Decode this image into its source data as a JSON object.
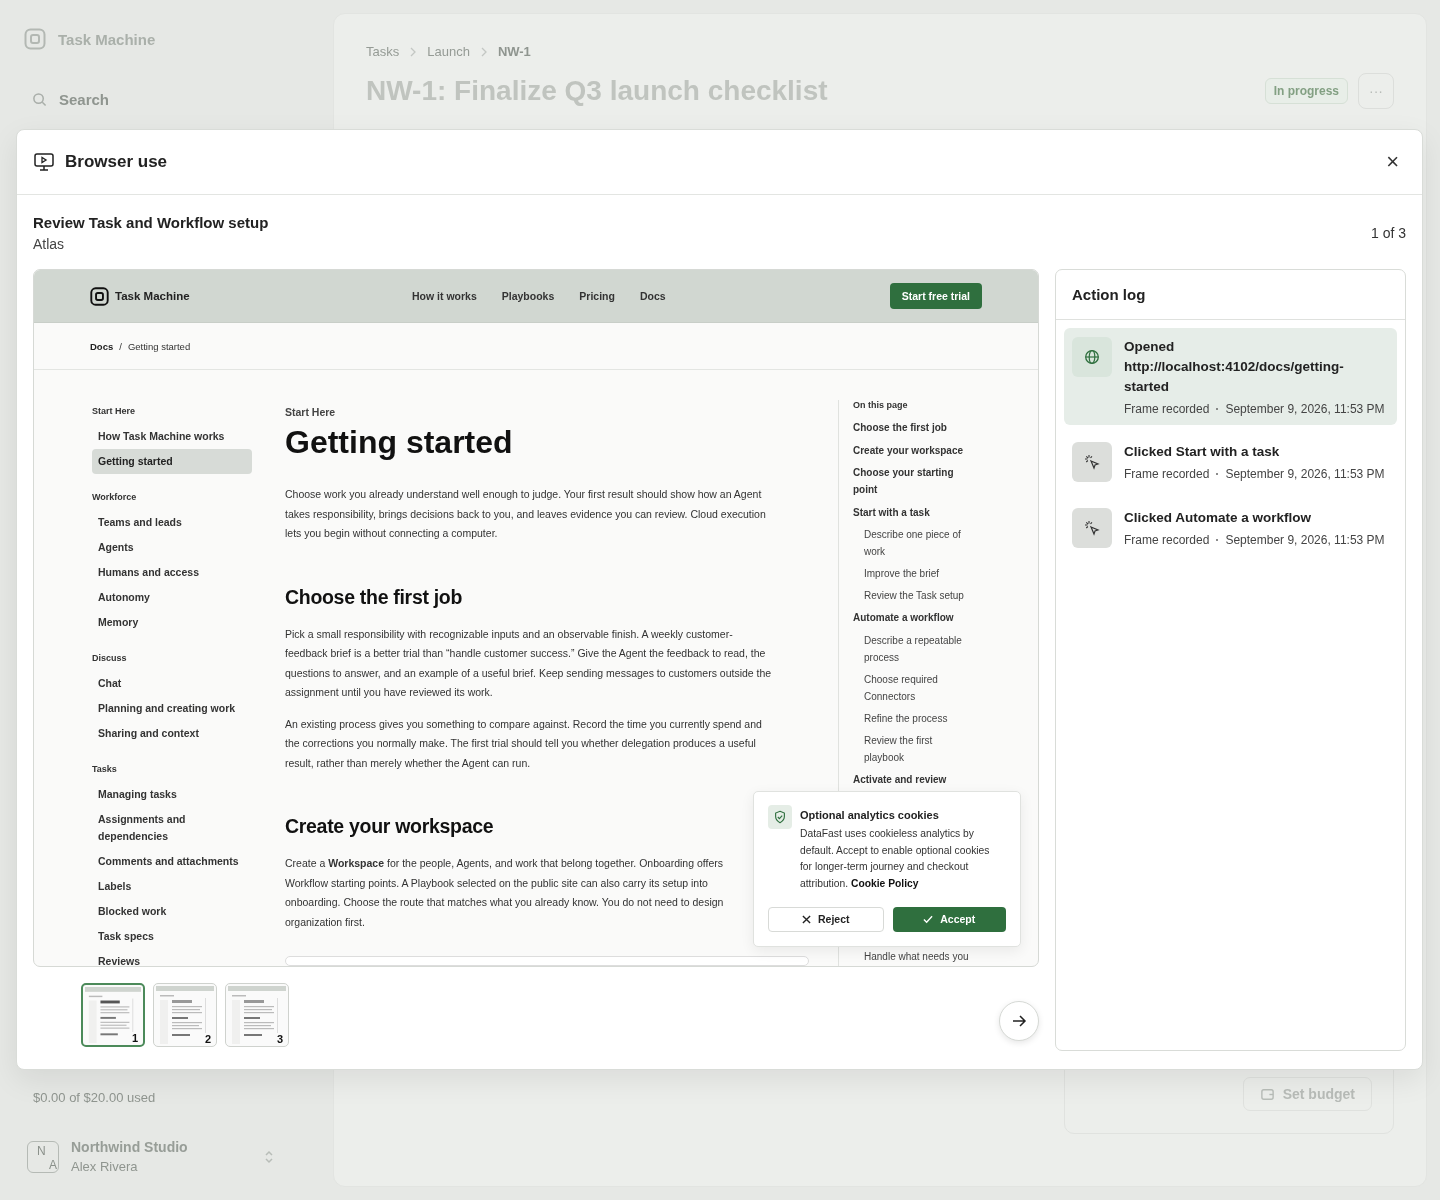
{
  "app": {
    "logo": "Task Machine",
    "search": {
      "placeholder": "Search"
    },
    "usage": "$0.00 of $20.00 used",
    "workspace": {
      "avatar": [
        "N",
        "A"
      ],
      "name": "Northwind Studio",
      "user": "Alex Rivera"
    }
  },
  "task": {
    "breadcrumbs": [
      "Tasks",
      "Launch",
      "NW-1"
    ],
    "title": "NW-1: Finalize Q3 launch checklist",
    "status": "In progress",
    "more": "···",
    "budget_button": "Set budget"
  },
  "modal": {
    "title": "Browser use",
    "close": "×",
    "session_title": "Review Task and Workflow setup",
    "agent": "Atlas",
    "counter": "1 of 3",
    "frame": {
      "nav": {
        "logo": "Task Machine",
        "links": [
          "How it works",
          "Playbooks",
          "Pricing",
          "Docs"
        ],
        "cta": "Start free trial"
      },
      "breadcrumbs": [
        "Docs",
        "Getting started"
      ],
      "breadcrumb_separator": "/",
      "sidebar": [
        {
          "heading": "Start Here",
          "items": [
            {
              "label": "How Task Machine works",
              "selected": false
            },
            {
              "label": "Getting started",
              "selected": true
            }
          ]
        },
        {
          "heading": "Workforce",
          "items": [
            {
              "label": "Teams and leads",
              "selected": false
            },
            {
              "label": "Agents",
              "selected": false
            },
            {
              "label": "Humans and access",
              "selected": false
            },
            {
              "label": "Autonomy",
              "selected": false
            },
            {
              "label": "Memory",
              "selected": false
            }
          ]
        },
        {
          "heading": "Discuss",
          "items": [
            {
              "label": "Chat",
              "selected": false
            },
            {
              "label": "Planning and creating work",
              "selected": false
            },
            {
              "label": "Sharing and context",
              "selected": false
            }
          ]
        },
        {
          "heading": "Tasks",
          "items": [
            {
              "label": "Managing tasks",
              "selected": false
            },
            {
              "label": "Assignments and dependencies",
              "selected": false
            },
            {
              "label": "Comments and attachments",
              "selected": false
            },
            {
              "label": "Labels",
              "selected": false
            },
            {
              "label": "Blocked work",
              "selected": false
            },
            {
              "label": "Task specs",
              "selected": false
            },
            {
              "label": "Reviews",
              "selected": false
            }
          ]
        }
      ],
      "content": {
        "eyebrow": "Start Here",
        "title": "Getting started",
        "intro": "Choose work you already understand well enough to judge. Your first result should show how an Agent\ntakes responsibility, brings decisions back to you, and leaves evidence you can review. Cloud execution\nlets you begin without connecting a computer.",
        "sections": [
          {
            "heading": "Choose the first job",
            "paragraphs": [
              "Pick a small responsibility with recognizable inputs and an observable finish. A weekly customer-\nfeedback brief is a better trial than “handle customer success.” Give the Agent the feedback to read, the\nquestions to answer, and an example of a useful brief. Keep sending messages to customers outside the\nassignment until you have reviewed its work.",
              "An existing process gives you something to compare against. Record the time you currently spend and\nthe corrections you normally make. The first trial should tell you whether delegation produces a useful\nresult, rather than merely whether the Agent can run."
            ]
          },
          {
            "heading": "Create your workspace",
            "paragraphs": [
              "Create a **Workspace** for the people, Agents, and work that belong together. Onboarding offers\nWorkflow starting points. A Playbook selected on the public site can also carry its setup into\nonboarding. Choose the route that matches what you already know. You do not need to design\norganization first."
            ]
          }
        ]
      },
      "toc": {
        "heading": "On this page",
        "items": [
          {
            "label": "Choose the first job"
          },
          {
            "label": "Create your workspace"
          },
          {
            "label": "Choose your starting point"
          },
          {
            "label": "Start with a task",
            "children": [
              {
                "label": "Describe one piece of work"
              },
              {
                "label": "Improve the brief"
              },
              {
                "label": "Review the Task setup"
              }
            ]
          },
          {
            "label": "Automate a workflow",
            "children": [
              {
                "label": "Describe a repeatable process"
              },
              {
                "label": "Choose required Connectors"
              },
              {
                "label": "Refine the process"
              },
              {
                "label": "Review the first playbook"
              }
            ]
          },
          {
            "label": "Activate and review",
            "children": [
              {
                "label": "Handle what needs you"
              }
            ]
          }
        ]
      },
      "cookie_banner": {
        "title": "Optional analytics cookies",
        "text": "DataFast uses cookieless analytics by default. Accept to enable optional cookies for longer-term journey and checkout attribution.",
        "link": "Cookie Policy",
        "reject": "Reject",
        "accept": "Accept"
      }
    },
    "thumbnails": [
      {
        "number": "1",
        "selected": true
      },
      {
        "number": "2",
        "selected": false
      },
      {
        "number": "3",
        "selected": false
      }
    ],
    "action_log": {
      "title": "Action log",
      "entries": [
        {
          "kind": "open",
          "title": "Opened http://localhost:4102/docs/getting-started",
          "meta": "Frame recorded",
          "time": "September 9, 2026, 11:53 PM",
          "selected": true
        },
        {
          "kind": "click",
          "title": "Clicked Start with a task",
          "meta": "Frame recorded",
          "time": "September 9, 2026, 11:53 PM",
          "selected": false
        },
        {
          "kind": "click",
          "title": "Clicked Automate a workflow",
          "meta": "Frame recorded",
          "time": "September 9, 2026, 11:53 PM",
          "selected": false
        }
      ]
    }
  }
}
